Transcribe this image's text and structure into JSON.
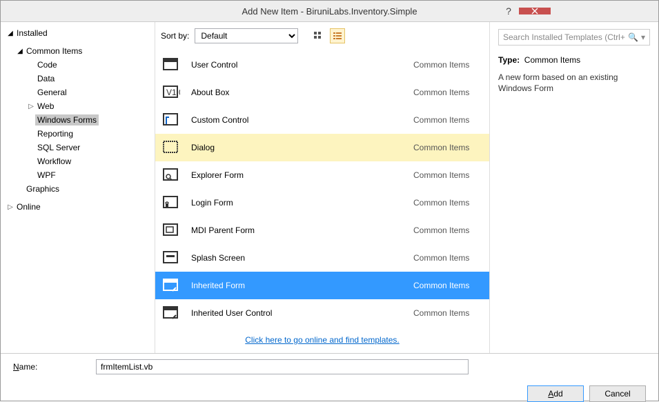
{
  "window": {
    "title": "Add New Item - BiruniLabs.Inventory.Simple"
  },
  "tree": {
    "installed": "Installed",
    "common": "Common Items",
    "code": "Code",
    "data": "Data",
    "general": "General",
    "web": "Web",
    "winforms": "Windows Forms",
    "reporting": "Reporting",
    "sql": "SQL Server",
    "workflow": "Workflow",
    "wpf": "WPF",
    "graphics": "Graphics",
    "online": "Online"
  },
  "toolbar": {
    "sortby": "Sort by:",
    "sort_value": "Default"
  },
  "search": {
    "placeholder": "Search Installed Templates (Ctrl+E)"
  },
  "templates": [
    {
      "name": "User Control",
      "cat": "Common Items",
      "sel": "",
      "icon": "usercontrol"
    },
    {
      "name": "About Box",
      "cat": "Common Items",
      "sel": "",
      "icon": "about"
    },
    {
      "name": "Custom Control",
      "cat": "Common Items",
      "sel": "",
      "icon": "custom"
    },
    {
      "name": "Dialog",
      "cat": "Common Items",
      "sel": "hover",
      "icon": "dialog"
    },
    {
      "name": "Explorer Form",
      "cat": "Common Items",
      "sel": "",
      "icon": "explorer"
    },
    {
      "name": "Login Form",
      "cat": "Common Items",
      "sel": "",
      "icon": "login"
    },
    {
      "name": "MDI Parent Form",
      "cat": "Common Items",
      "sel": "",
      "icon": "mdi"
    },
    {
      "name": "Splash Screen",
      "cat": "Common Items",
      "sel": "",
      "icon": "splash"
    },
    {
      "name": "Inherited Form",
      "cat": "Common Items",
      "sel": "selected",
      "icon": "inhform"
    },
    {
      "name": "Inherited User Control",
      "cat": "Common Items",
      "sel": "",
      "icon": "inhuc"
    }
  ],
  "online_link": "Click here to go online and find templates.",
  "info": {
    "type_label": "Type:",
    "type_value": "Common Items",
    "description": "A new form based on an existing Windows Form"
  },
  "footer": {
    "name_label": "Name:",
    "name_value": "frmItemList.vb",
    "add": "Add",
    "cancel": "Cancel"
  }
}
